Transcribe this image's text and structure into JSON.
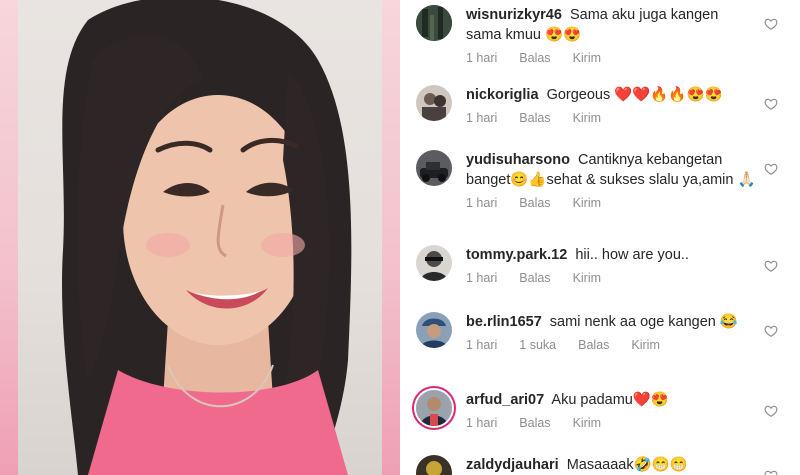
{
  "comments": [
    {
      "username": "wisnurizkyr46",
      "text": "Sama aku juga kangen sama kmuu 😍😍",
      "time": "1 hari",
      "likes": "",
      "reply": "Balas",
      "send": "Kirim",
      "avatar_color": "#3b4a3e"
    },
    {
      "username": "nickoriglia",
      "text": "Gorgeous ❤️❤️🔥🔥😍😍",
      "time": "1 hari",
      "likes": "",
      "reply": "Balas",
      "send": "Kirim",
      "avatar_color": "#6b5a52"
    },
    {
      "username": "yudisuharsono",
      "text": "Cantiknya kebangetan banget😊👍sehat & sukses slalu ya,amin 🙏🏻",
      "time": "1 hari",
      "likes": "",
      "reply": "Balas",
      "send": "Kirim",
      "avatar_color": "#2d2f33"
    },
    {
      "username": "tommy.park.12",
      "text": "hii.. how are you..",
      "time": "1 hari",
      "likes": "",
      "reply": "Balas",
      "send": "Kirim",
      "avatar_color": "#4a4a4a"
    },
    {
      "username": "be.rlin1657",
      "text": "sami nenk aa oge kangen 😂",
      "time": "1 hari",
      "likes": "1 suka",
      "reply": "Balas",
      "send": "Kirim",
      "avatar_color": "#2f4f7a"
    },
    {
      "username": "arfud_ari07",
      "text": "Aku padamu❤️😍",
      "time": "1 hari",
      "likes": "",
      "reply": "Balas",
      "send": "Kirim",
      "avatar_color": "#1e2a3a"
    },
    {
      "username": "zaldydjauhari",
      "text": "Masaaaak🤣😁😁",
      "time": "",
      "likes": "",
      "reply": "",
      "send": "",
      "avatar_color": "#3a3226"
    }
  ],
  "colors": {
    "text": "#262626",
    "meta": "#8e8e8e",
    "frame_pink": "#f3c2cc",
    "story_ring": "#d62976"
  },
  "icons": [
    "heart-outline-icon"
  ]
}
